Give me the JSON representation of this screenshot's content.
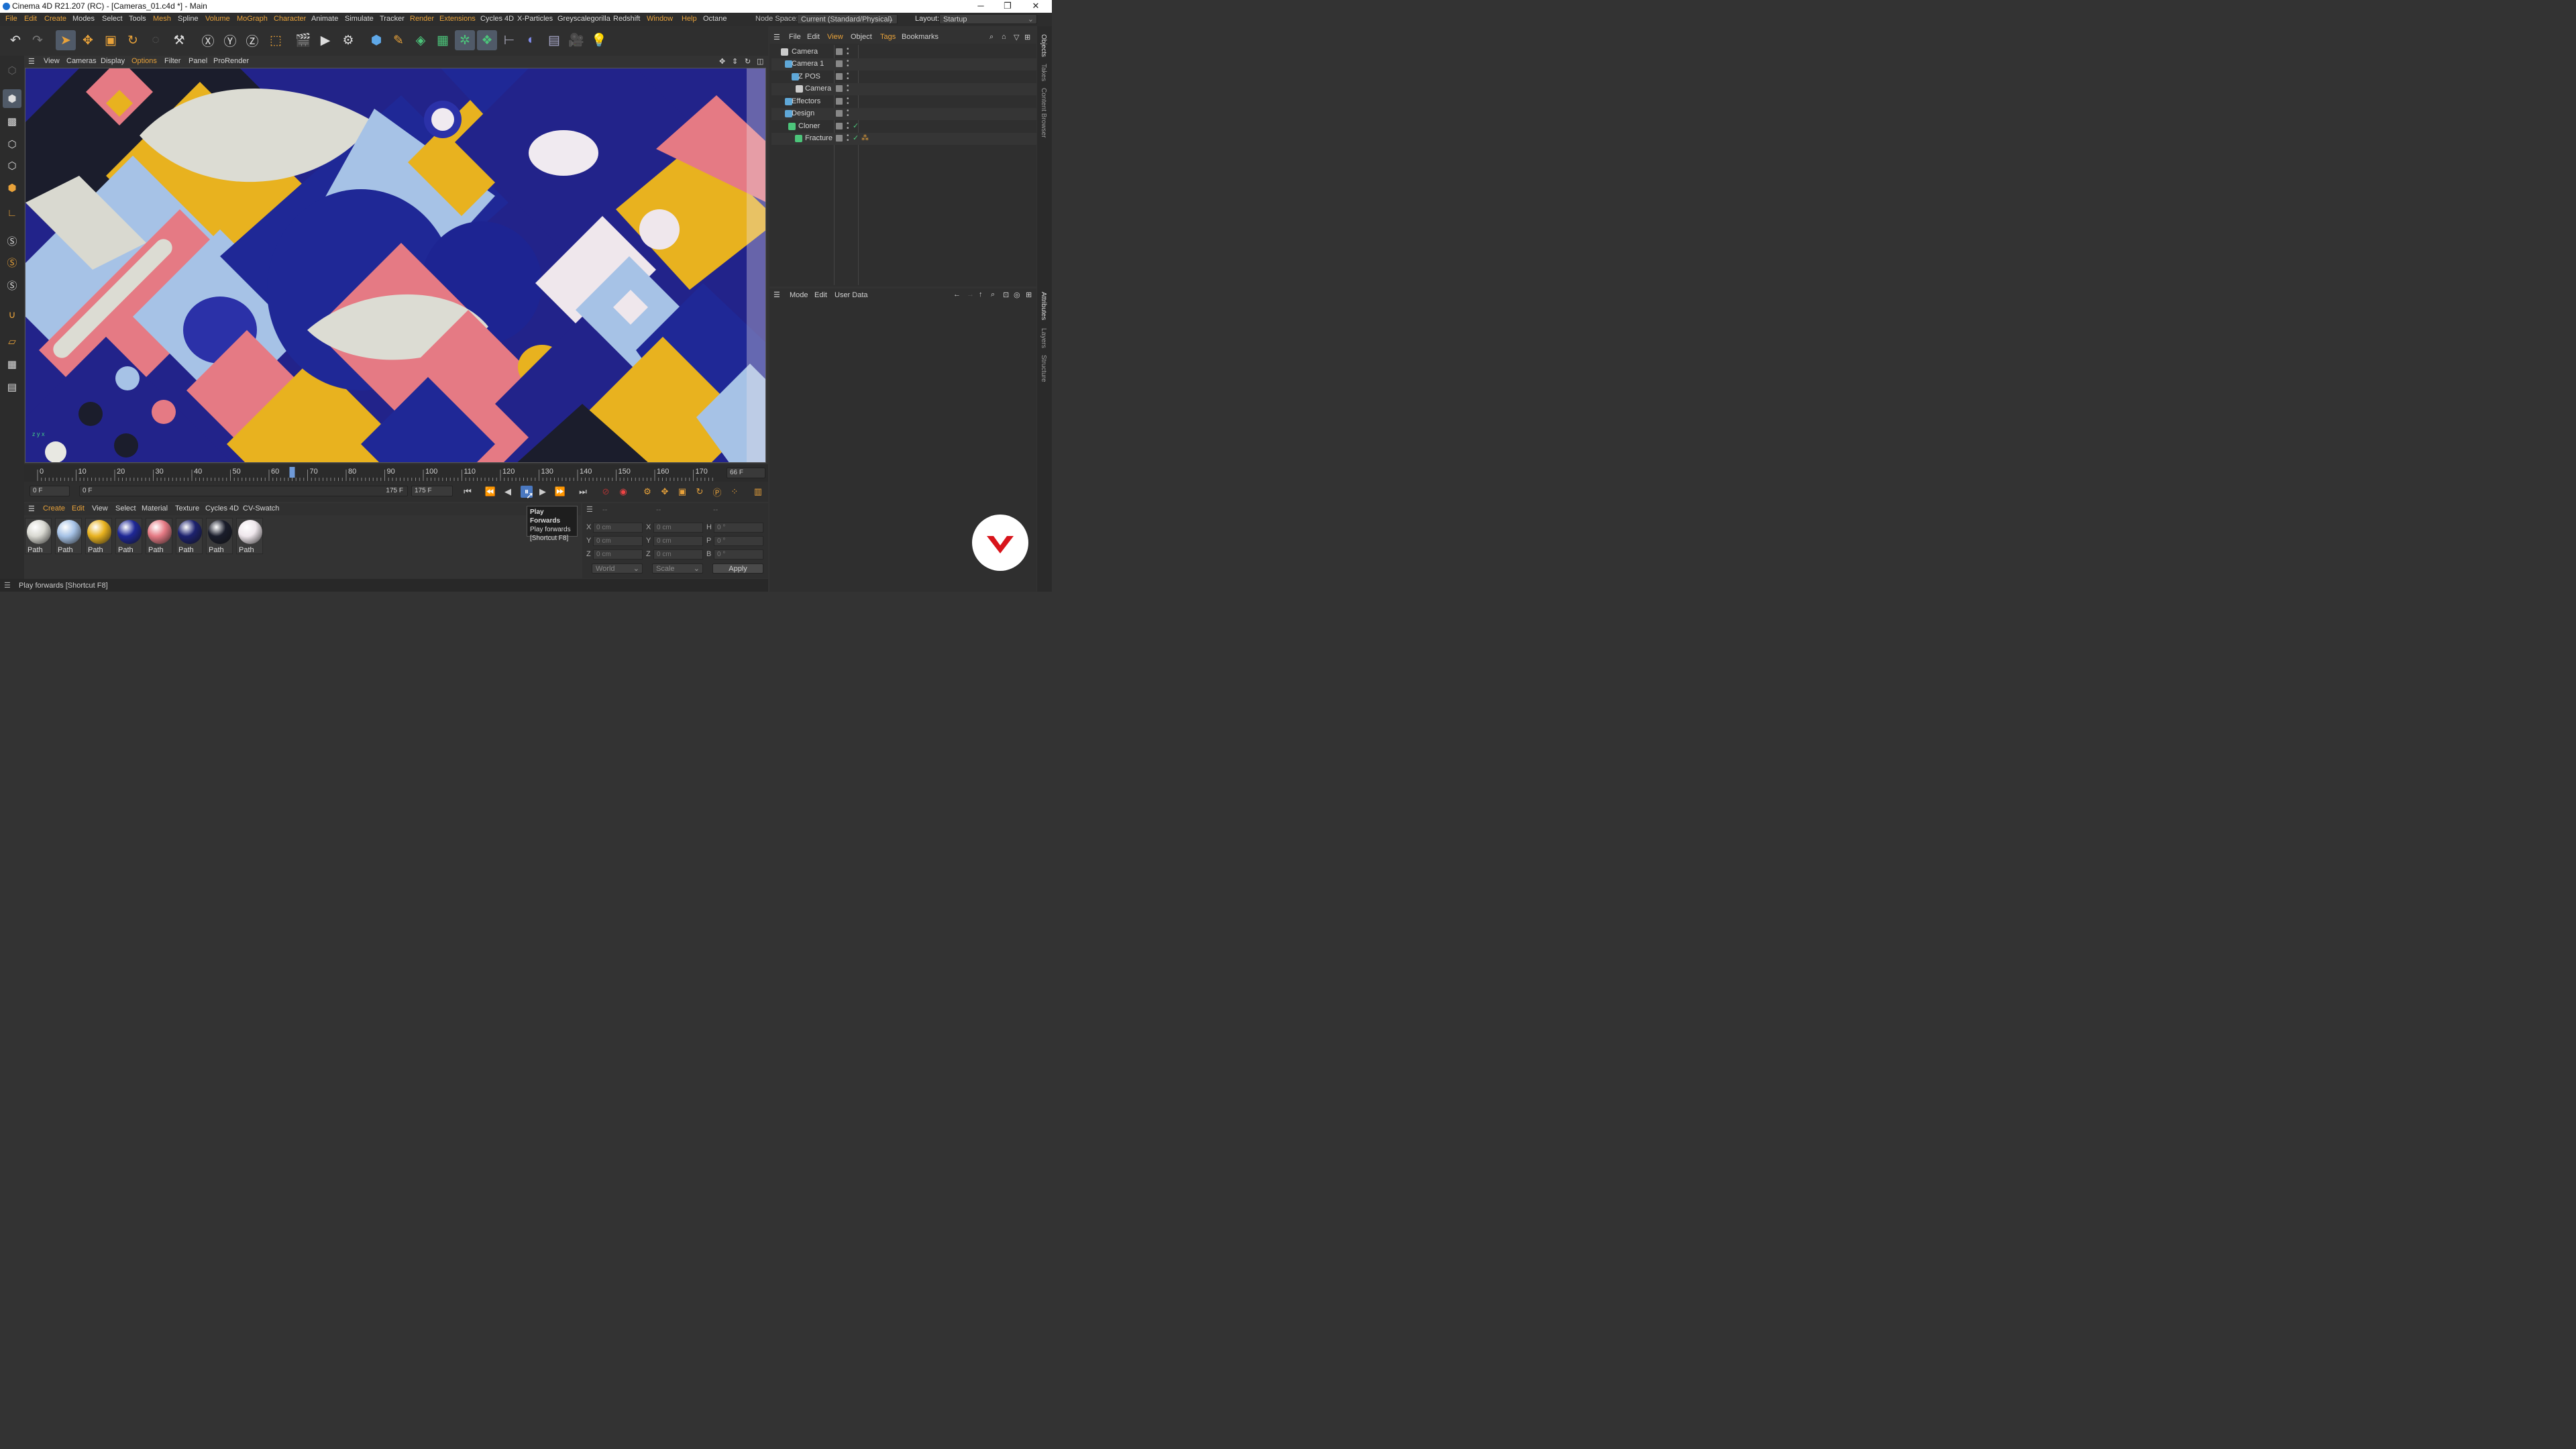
{
  "window": {
    "title": "Cinema 4D R21.207 (RC) - [Cameras_01.c4d *] - Main",
    "min_icon": "minimize-icon",
    "max_icon": "restore-icon",
    "close_icon": "close-icon"
  },
  "menubar": {
    "items": [
      "File",
      "Edit",
      "Create",
      "Modes",
      "Select",
      "Tools",
      "Mesh",
      "Spline",
      "Volume",
      "MoGraph",
      "Character",
      "Animate",
      "Simulate",
      "Tracker",
      "Render",
      "Extensions",
      "Cycles 4D",
      "X-Particles",
      "Greyscalegorilla",
      "Redshift",
      "Window",
      "Help",
      "Octane"
    ],
    "node_space_label": "Node Space:",
    "node_space_value": "Current (Standard/Physical)",
    "layout_label": "Layout:",
    "layout_value": "Startup"
  },
  "viewport_menu": {
    "items": [
      "View",
      "Cameras",
      "Display",
      "Options",
      "Filter",
      "Panel",
      "ProRender"
    ]
  },
  "timeline": {
    "ticks": [
      "0",
      "10",
      "20",
      "30",
      "40",
      "50",
      "60",
      "70",
      "80",
      "90",
      "100",
      "110",
      "120",
      "130",
      "140",
      "150",
      "160",
      "170"
    ],
    "current_frame_display": "66 F",
    "playhead_frame": 66,
    "max_frame": 175
  },
  "transport": {
    "start_frame": "0 F",
    "range_start": "0 F",
    "range_end": "175 F",
    "end_frame": "175 F"
  },
  "tooltip": {
    "title": "Play Forwards",
    "line1": "Play forwards",
    "line2": "[Shortcut F8]"
  },
  "material_menu": {
    "items": [
      "Create",
      "Edit",
      "View",
      "Select",
      "Material",
      "Texture",
      "Cycles 4D",
      "CV-Swatch"
    ]
  },
  "materials": [
    {
      "label": "Path",
      "color": "#d9d9d2"
    },
    {
      "label": "Path",
      "color": "#a6c2e6"
    },
    {
      "label": "Path",
      "color": "#e8b21f"
    },
    {
      "label": "Path",
      "color": "#1f2896"
    },
    {
      "label": "Path",
      "color": "#e57a84"
    },
    {
      "label": "Path",
      "color": "#1d226e"
    },
    {
      "label": "Path",
      "color": "#1a1d2b"
    },
    {
      "label": "Path",
      "color": "#efe7ec"
    }
  ],
  "coordinates": {
    "header1": "--",
    "header2": "--",
    "header3": "--",
    "rows": [
      {
        "a": "X",
        "av": "0 cm",
        "b": "X",
        "bv": "0 cm",
        "c": "H",
        "cv": "0 °"
      },
      {
        "a": "Y",
        "av": "0 cm",
        "b": "Y",
        "bv": "0 cm",
        "c": "P",
        "cv": "0 °"
      },
      {
        "a": "Z",
        "av": "0 cm",
        "b": "Z",
        "bv": "0 cm",
        "c": "B",
        "cv": "0 °"
      }
    ],
    "space": "World",
    "mode": "Scale",
    "apply": "Apply"
  },
  "status": "Play forwards [Shortcut F8]",
  "objects_menu": {
    "items": [
      "File",
      "Edit",
      "View",
      "Object",
      "Tags",
      "Bookmarks"
    ]
  },
  "objects": [
    {
      "name": "Camera"
    },
    {
      "name": "Camera 1"
    },
    {
      "name": "Z POS"
    },
    {
      "name": "Camera"
    },
    {
      "name": "Effectors"
    },
    {
      "name": "Design"
    },
    {
      "name": "Cloner"
    },
    {
      "name": "Fracture"
    }
  ],
  "attributes_menu": {
    "items": [
      "Mode",
      "Edit",
      "User Data"
    ]
  },
  "side_tabs": {
    "top": [
      "Objects",
      "Takes",
      "Content Browser"
    ],
    "bottom": [
      "Attributes",
      "Layers",
      "Structure"
    ]
  },
  "colors": {
    "accent_orange": "#e8a23a",
    "navy": "#22238a",
    "yellow": "#e8b21f",
    "pink": "#e57a84",
    "lightblue": "#a6c2e6",
    "cream": "#dcdcd3"
  }
}
